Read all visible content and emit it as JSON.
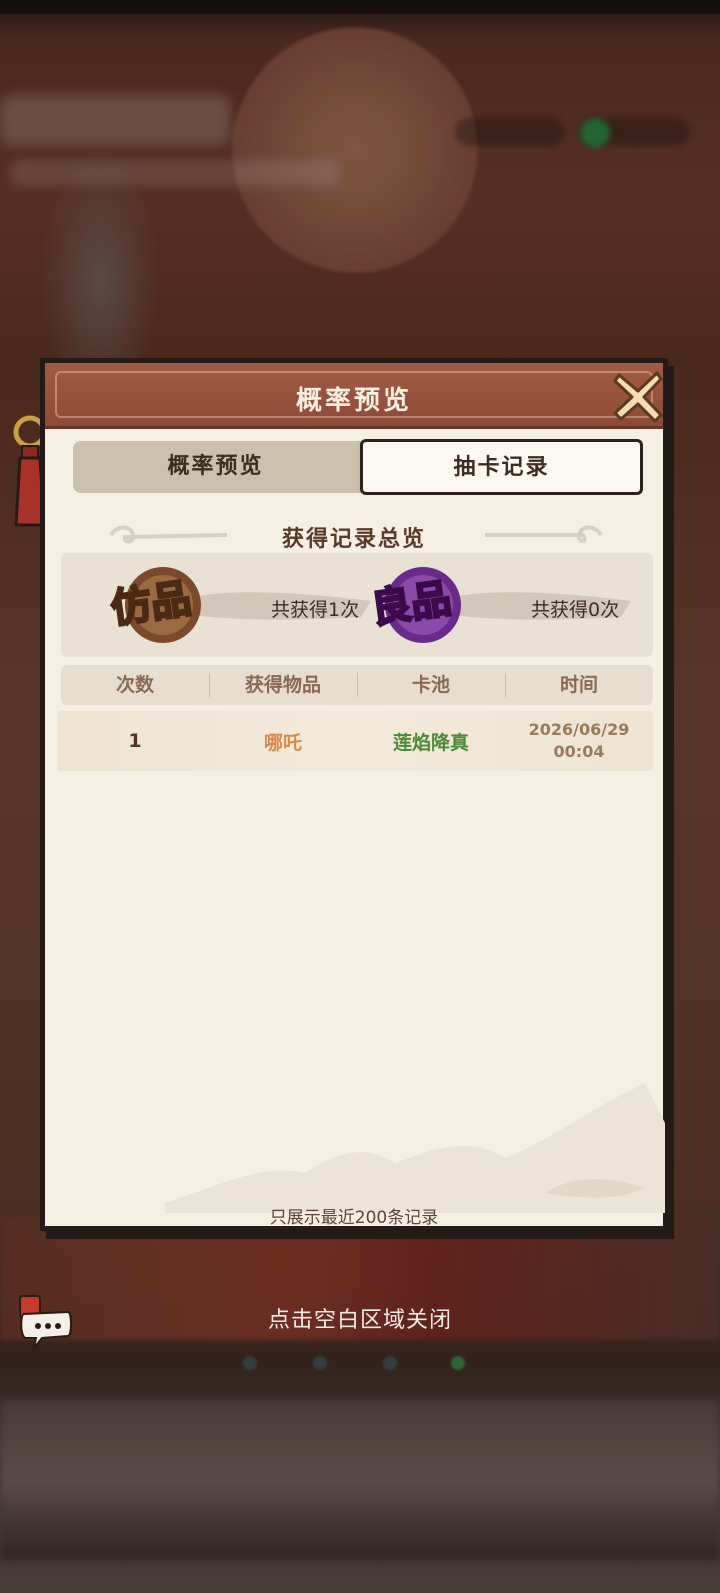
{
  "dialog": {
    "title": "概率预览",
    "tabs": [
      {
        "label": "概率预览",
        "active": false
      },
      {
        "label": "抽卡记录",
        "active": true
      }
    ],
    "summary": {
      "title": "获得记录总览",
      "grades": [
        {
          "badge_text": "仿品",
          "count_text": "共获得1次",
          "color": "#c8864a"
        },
        {
          "badge_text": "良品",
          "count_text": "共获得0次",
          "color": "#a84ad0"
        }
      ]
    },
    "table": {
      "headers": [
        "次数",
        "获得物品",
        "卡池",
        "时间"
      ],
      "rows": [
        {
          "count": "1",
          "item": "哪吒",
          "pool": "莲焰降真",
          "date": "2026/06/29",
          "time": "00:04"
        }
      ]
    },
    "footer_note": "只展示最近200条记录"
  },
  "close_hint": "点击空白区域关闭",
  "icons": {
    "close": "close-x-icon",
    "chat": "chat-bubble-icon"
  },
  "colors": {
    "header": "#8e4a38",
    "panel": "#f6f0e4",
    "item_name": "#d68a4c",
    "pool_name": "#4c8a38"
  }
}
